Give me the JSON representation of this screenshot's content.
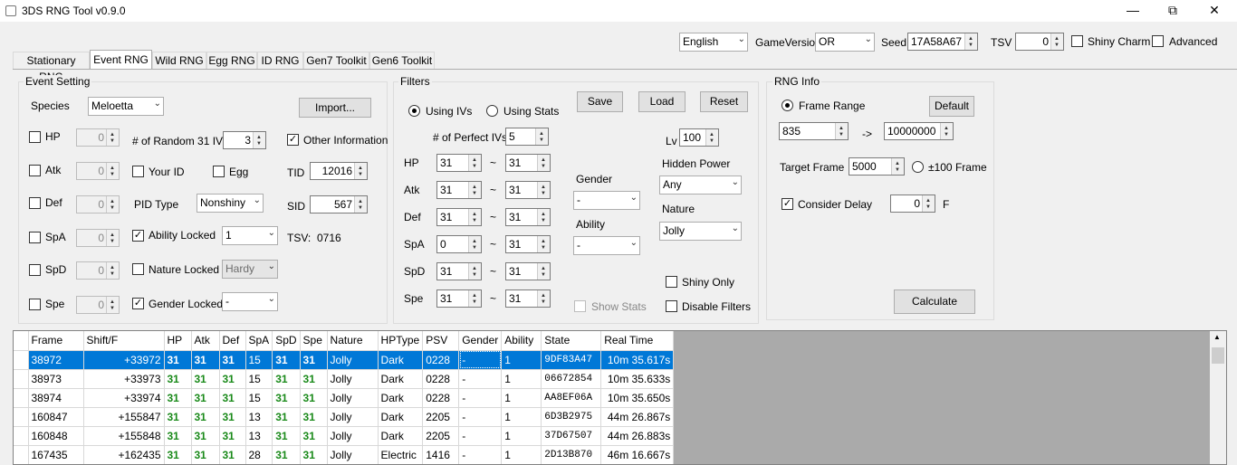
{
  "window": {
    "title": "3DS RNG Tool v0.9.0"
  },
  "top": {
    "language": "English",
    "game_version_label": "GameVersion",
    "game_version": "OR",
    "seed_label": "Seed",
    "seed": "17A58A67",
    "tsv_label": "TSV",
    "tsv": "0",
    "shiny_charm_label": "Shiny Charm",
    "advanced_label": "Advanced"
  },
  "tabs": [
    "Stationary RNG",
    "Event RNG",
    "Wild RNG",
    "Egg RNG",
    "ID RNG",
    "Gen7 Toolkit",
    "Gen6 Toolkit"
  ],
  "event": {
    "title": "Event Setting",
    "species_label": "Species",
    "species": "Meloetta",
    "import_label": "Import...",
    "stats": [
      {
        "label": "HP",
        "value": "0"
      },
      {
        "label": "Atk",
        "value": "0"
      },
      {
        "label": "Def",
        "value": "0"
      },
      {
        "label": "SpA",
        "value": "0"
      },
      {
        "label": "SpD",
        "value": "0"
      },
      {
        "label": "Spe",
        "value": "0"
      }
    ],
    "random_ivs_label": "# of Random 31 IVs",
    "random_ivs": "3",
    "other_info_label": "Other Information",
    "your_id_label": "Your ID",
    "egg_label": "Egg",
    "tid_label": "TID",
    "tid": "12016",
    "pid_type_label": "PID Type",
    "pid_type": "Nonshiny",
    "sid_label": "SID",
    "sid": "567",
    "ability_locked_label": "Ability Locked",
    "ability_value": "1",
    "tsv_text": "TSV:",
    "tsv_value": "0716",
    "nature_locked_label": "Nature Locked",
    "nature_value": "Hardy",
    "gender_locked_label": "Gender Locked",
    "gender_value": "-"
  },
  "filters": {
    "title": "Filters",
    "using_ivs_label": "Using IVs",
    "using_stats_label": "Using Stats",
    "save_label": "Save",
    "load_label": "Load",
    "reset_label": "Reset",
    "perfect_ivs_label": "# of Perfect IVs",
    "perfect_ivs": "5",
    "lv_label": "Lv",
    "lv": "100",
    "rows": [
      {
        "label": "HP",
        "min": "31",
        "max": "31"
      },
      {
        "label": "Atk",
        "min": "31",
        "max": "31"
      },
      {
        "label": "Def",
        "min": "31",
        "max": "31"
      },
      {
        "label": "SpA",
        "min": "0",
        "max": "31"
      },
      {
        "label": "SpD",
        "min": "31",
        "max": "31"
      },
      {
        "label": "Spe",
        "min": "31",
        "max": "31"
      }
    ],
    "tilde": "~",
    "gender_label": "Gender",
    "gender": "-",
    "ability_label": "Ability",
    "ability": "-",
    "hidden_power_label": "Hidden Power",
    "hidden_power": "Any",
    "nature_label": "Nature",
    "nature": "Jolly",
    "shiny_only_label": "Shiny Only",
    "show_stats_label": "Show Stats",
    "disable_filters_label": "Disable Filters"
  },
  "rng": {
    "title": "RNG Info",
    "frame_range_label": "Frame Range",
    "default_label": "Default",
    "frame_min": "835",
    "arrow": "->",
    "frame_max": "10000000",
    "target_frame_label": "Target Frame",
    "target_frame": "5000",
    "pm100_label": "±100 Frame",
    "consider_delay_label": "Consider Delay",
    "delay": "0",
    "f_label": "F",
    "calculate_label": "Calculate"
  },
  "results": {
    "headers": [
      "Frame",
      "Shift/F",
      "HP",
      "Atk",
      "Def",
      "SpA",
      "SpD",
      "Spe",
      "Nature",
      "HPType",
      "PSV",
      "Gender",
      "Ability",
      "State",
      "Real Time"
    ],
    "rows": [
      [
        "38972",
        "+33972",
        "31",
        "31",
        "31",
        "15",
        "31",
        "31",
        "Jolly",
        "Dark",
        "0228",
        "-",
        "1",
        "9DF83A47",
        "10m 35.617s"
      ],
      [
        "38973",
        "+33973",
        "31",
        "31",
        "31",
        "15",
        "31",
        "31",
        "Jolly",
        "Dark",
        "0228",
        "-",
        "1",
        "06672854",
        "10m 35.633s"
      ],
      [
        "38974",
        "+33974",
        "31",
        "31",
        "31",
        "15",
        "31",
        "31",
        "Jolly",
        "Dark",
        "0228",
        "-",
        "1",
        "AA8EF06A",
        "10m 35.650s"
      ],
      [
        "160847",
        "+155847",
        "31",
        "31",
        "31",
        "13",
        "31",
        "31",
        "Jolly",
        "Dark",
        "2205",
        "-",
        "1",
        "6D3B2975",
        "44m 26.867s"
      ],
      [
        "160848",
        "+155848",
        "31",
        "31",
        "31",
        "13",
        "31",
        "31",
        "Jolly",
        "Dark",
        "2205",
        "-",
        "1",
        "37D67507",
        "44m 26.883s"
      ],
      [
        "167435",
        "+162435",
        "31",
        "31",
        "31",
        "28",
        "31",
        "31",
        "Jolly",
        "Electric",
        "1416",
        "-",
        "1",
        "2D13B870",
        "46m 16.667s"
      ]
    ]
  }
}
